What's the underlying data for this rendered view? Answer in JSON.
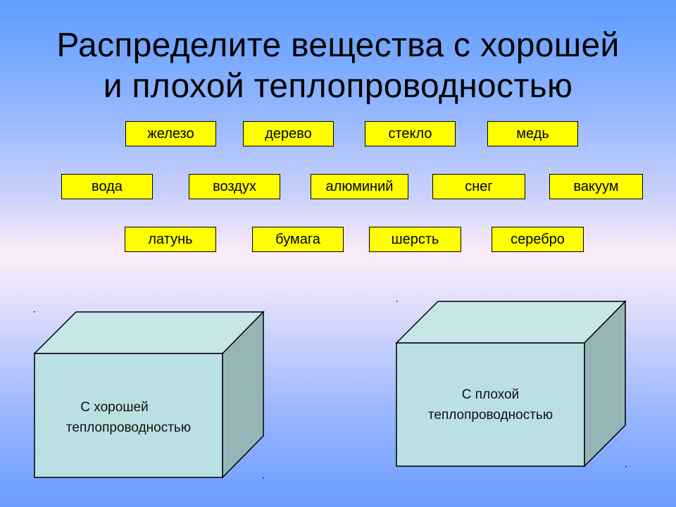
{
  "slide": {
    "title_lines": [
      "Распределите вещества с хорошей",
      "и плохой теплопроводностью"
    ],
    "colors": {
      "chip_fill": "#ffff00",
      "cube_front": "#bae0e3",
      "cube_top": "#c8e5e8",
      "cube_side": "#96b5b6"
    }
  },
  "substances": {
    "row1": [
      "железо",
      "дерево",
      "стекло",
      "медь"
    ],
    "row2": [
      "вода",
      "воздух",
      "алюминий",
      "снег",
      "вакуум"
    ],
    "row3": [
      "латунь",
      "бумага",
      "шерсть",
      "серебро"
    ]
  },
  "targets": {
    "good": {
      "line1": "С хорошей",
      "line2": "теплопроводностью"
    },
    "poor": {
      "line1": "С плохой",
      "line2": "теплопроводностью"
    }
  }
}
